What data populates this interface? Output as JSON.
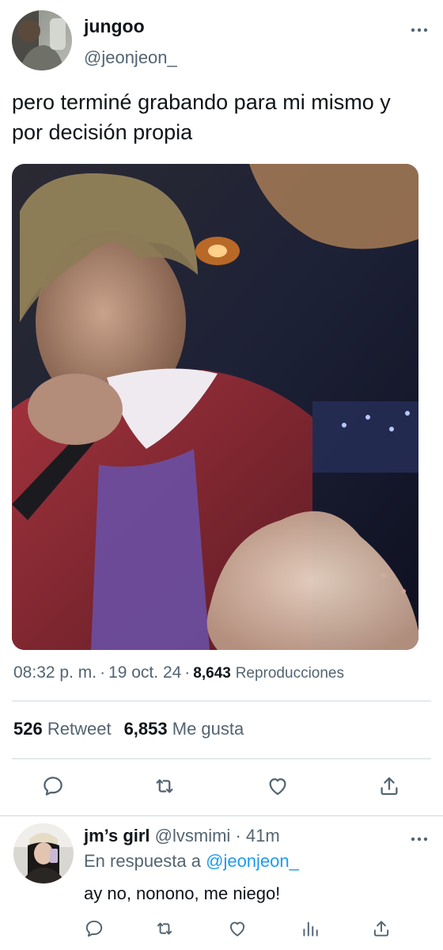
{
  "tweet": {
    "author_name": "jungoo",
    "author_handle": "@jeonjeon_",
    "text": "pero terminé grabando para mi mismo y por decisión propia",
    "time": "08:32 p. m.",
    "date": "19 oct. 24",
    "separator": "·",
    "views_count": "8,643",
    "views_label": "Reproducciones",
    "retweet_count": "526",
    "retweet_label": "Retweet",
    "like_count": "6,853",
    "like_label": "Me gusta",
    "actions": [
      "reply-icon",
      "retweet-icon",
      "like-icon",
      "share-icon"
    ],
    "more_icon": "more-dots-icon"
  },
  "reply": {
    "author_name": "jm’s girl",
    "author_handle": "@lvsmimi",
    "separator": "·",
    "time": "41m",
    "in_reply_prefix": "En respuesta a",
    "in_reply_mention": "@jeonjeon_",
    "text": "ay no, nonono, me niego!",
    "actions": [
      "reply-icon",
      "retweet-icon",
      "like-icon",
      "views-icon",
      "share-icon"
    ]
  },
  "colors": {
    "text_primary": "#0f1419",
    "text_secondary": "#536471",
    "link": "#1d9bf0",
    "divider": "#cfd9de"
  }
}
